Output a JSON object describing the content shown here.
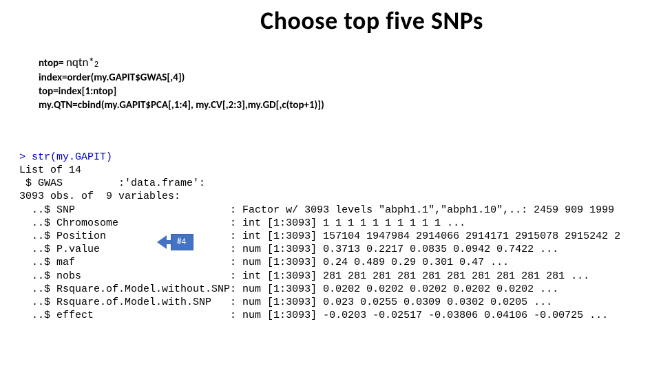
{
  "title": "Choose top five SNPs",
  "code": {
    "l1_prefix": "ntop= ",
    "l1_expr_a": "nqtn*",
    "l1_expr_b": "2",
    "l2": "index=order(my.GAPIT$GWAS[,4])",
    "l3": "top=index[1:ntop]",
    "l4": "my.QTN=cbind(my.GAPIT$PCA[,1:4], my.CV[,2:3],my.GD[,c(top+1)])"
  },
  "console": {
    "prompt_line": "> str(my.GAPIT)",
    "lines": [
      "List of 14",
      " $ GWAS         :'data.frame':",
      "3093 obs. of  9 variables:",
      "  ..$ SNP                         : Factor w/ 3093 levels \"abph1.1\",\"abph1.10\",..: 2459 909 1999",
      "  ..$ Chromosome                  : int [1:3093] 1 1 1 1 1 1 1 1 1 1 ...",
      "  ..$ Position                    : int [1:3093] 157104 1947984 2914066 2914171 2915078 2915242 2",
      "  ..$ P.value                     : num [1:3093] 0.3713 0.2217 0.0835 0.0942 0.7422 ...",
      "  ..$ maf                         : num [1:3093] 0.24 0.489 0.29 0.301 0.47 ...",
      "  ..$ nobs                        : int [1:3093] 281 281 281 281 281 281 281 281 281 281 ...",
      "  ..$ Rsquare.of.Model.without.SNP: num [1:3093] 0.0202 0.0202 0.0202 0.0202 0.0202 ...",
      "  ..$ Rsquare.of.Model.with.SNP   : num [1:3093] 0.023 0.0255 0.0309 0.0302 0.0205 ...",
      "  ..$ effect                      : num [1:3093] -0.0203 -0.02517 -0.03806 0.04106 -0.00725 ..."
    ]
  },
  "callout": {
    "label": "#4"
  }
}
